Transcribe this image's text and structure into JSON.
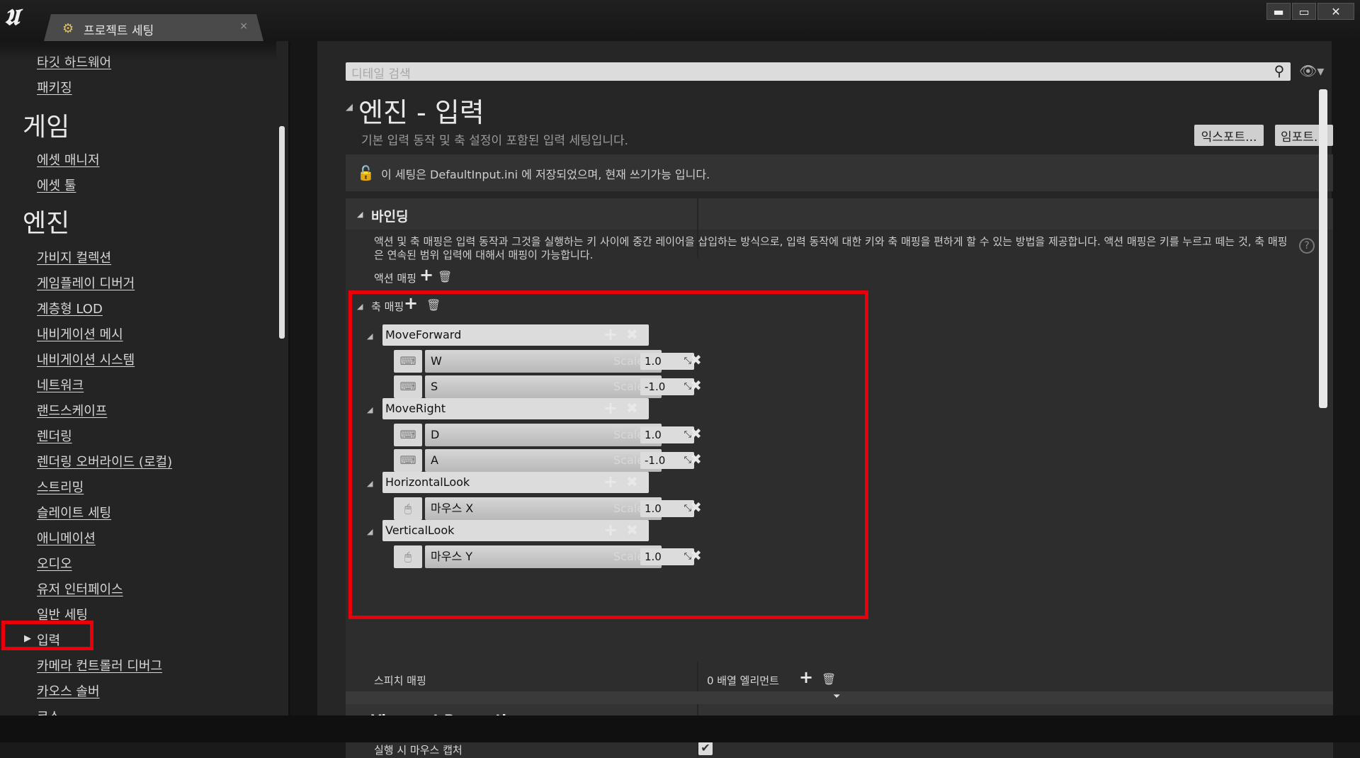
{
  "titlebar": {
    "tab_title": "프로젝트 세팅",
    "tab_close": "×",
    "minimize": "▬",
    "maximize": "▭",
    "close": "✕"
  },
  "sidebar": {
    "items_top": [
      "타깃 하드웨어",
      "패키징"
    ],
    "heading_game": "게임",
    "items_game": [
      "에셋 매니저",
      "에셋 툴"
    ],
    "heading_engine": "엔진",
    "items_engine": [
      "가비지 컬렉션",
      "게임플레이 디버거",
      "계층형 LOD",
      "내비게이션 메시",
      "내비게이션 시스템",
      "네트워크",
      "랜드스케이프",
      "렌더링",
      "렌더링 오버라이드 (로컬)",
      "스트리밍",
      "슬레이트 세팅",
      "애니메이션",
      "오디오",
      "유저 인터페이스",
      "일반 세팅",
      "입력",
      "카메라 컨트롤러 디버그",
      "카오스 솔버",
      "코스"
    ],
    "selected": "입력"
  },
  "details": {
    "search_placeholder": "디테일 검색",
    "title": "엔진 - 입력",
    "description": "기본 입력 동작 및 축 설정이 포함된 입력 세팅입니다.",
    "export_label": "익스포트...",
    "import_label": "임포트...",
    "info": "이 세팅은 DefaultInput.ini 에 저장되었으며, 현재 쓰기가능 입니다."
  },
  "bindings": {
    "title": "바인딩",
    "description": "액션 및 축 매핑은 입력 동작과 그것을 실행하는 키 사이에 중간 레이어을 삽입하는 방식으로, 입력 동작에 대한 키와 축 매핑을 편하게 할 수 있는 방법을 제공합니다. 액션 매핑은 키를 누르고 떼는 것, 축 매핑은 연속된 범위 입력에 대해서 매핑이 가능합니다.",
    "action_mapping_label": "액션 매핑",
    "axis_mapping_label": "축 매핑",
    "scale_label": "Scale",
    "axes": [
      {
        "name": "MoveForward",
        "keys": [
          {
            "key": "W",
            "scale": "1.0",
            "icon": "keyboard-icon"
          },
          {
            "key": "S",
            "scale": "-1.0",
            "icon": "keyboard-icon"
          }
        ]
      },
      {
        "name": "MoveRight",
        "keys": [
          {
            "key": "D",
            "scale": "1.0",
            "icon": "keyboard-icon"
          },
          {
            "key": "A",
            "scale": "-1.0",
            "icon": "keyboard-icon"
          }
        ]
      },
      {
        "name": "HorizontalLook",
        "keys": [
          {
            "key": "마우스 X",
            "scale": "1.0",
            "icon": "mouse-icon"
          }
        ]
      },
      {
        "name": "VerticalLook",
        "keys": [
          {
            "key": "마우스 Y",
            "scale": "1.0",
            "icon": "mouse-icon"
          }
        ]
      }
    ],
    "speech_mapping_label": "스피치 매핑",
    "speech_mapping_value": "0 배열 엘리먼트"
  },
  "viewport": {
    "title": "Viewport Properties",
    "capture_label": "실행 시 마우스 캡처",
    "capture_checked": true
  },
  "colors": {
    "highlight": "#e8000b"
  }
}
